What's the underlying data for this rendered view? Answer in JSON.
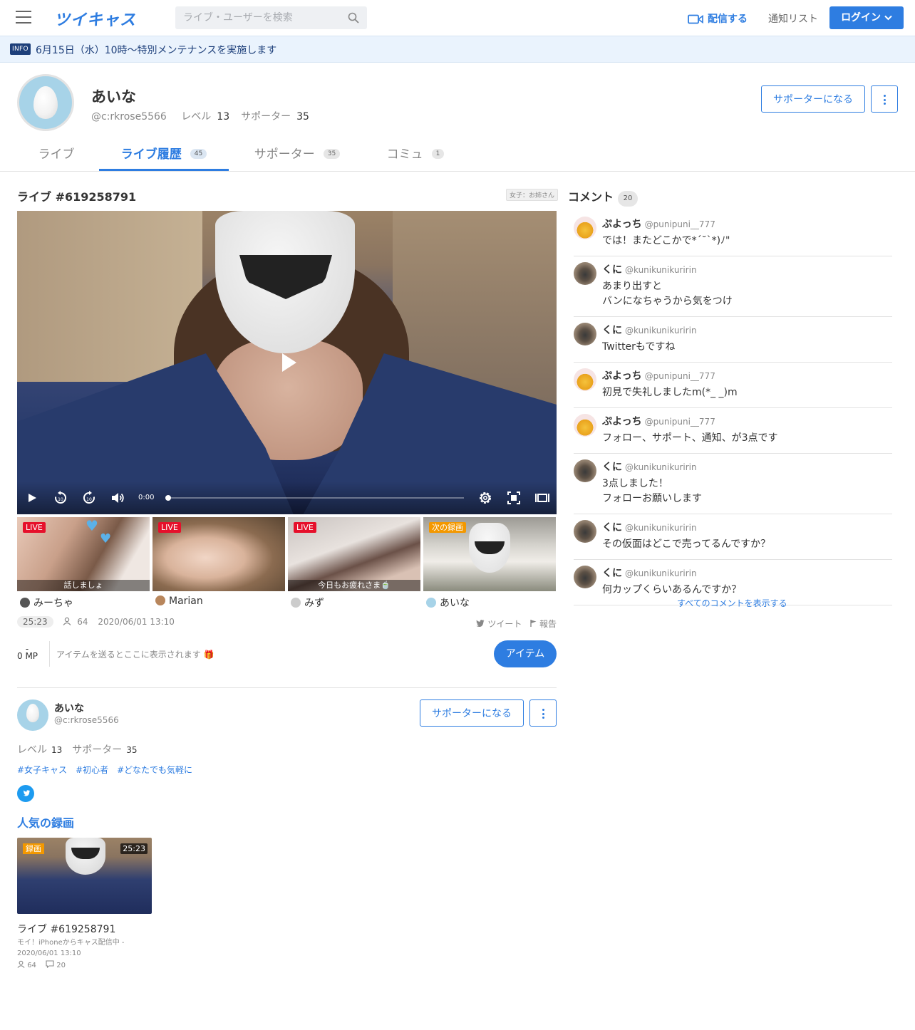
{
  "header": {
    "logo": "ツイキャス",
    "search_placeholder": "ライブ・ユーザーを検索",
    "cast_label": "配信する",
    "notif_label": "通知リスト",
    "login_label": "ログイン",
    "accent": "#2e7de1"
  },
  "info": {
    "badge": "INFO",
    "message": "6月15日（水）10時〜特別メンテナンスを実施します"
  },
  "profile": {
    "name": "あいな",
    "id": "@c:rkrose5566",
    "level_label": "レベル",
    "level": "13",
    "supporter_label": "サポーター",
    "supporters": "35",
    "support_button": "サポーターになる"
  },
  "tabs": [
    {
      "label": "ライブ",
      "count": ""
    },
    {
      "label": "ライブ履歴",
      "count": "45"
    },
    {
      "label": "サポーター",
      "count": "35"
    },
    {
      "label": "コミュ",
      "count": "1"
    }
  ],
  "live": {
    "title": "ライブ #619258791",
    "category": "女子：お姉さん",
    "time_display": "0:00",
    "progress": 0,
    "duration": "25:23",
    "viewers": "64",
    "datetime": "2020/06/01 13:10",
    "tweet": "ツイート",
    "report": "報告",
    "mp_dash": "-",
    "mp": "0 MP",
    "item_msg": "アイテムを送るとここに表示されます 🎁",
    "item_button": "アイテム"
  },
  "thumbs": [
    {
      "label": "LIVE",
      "caption": "話しましょ",
      "name": "みーちゃ"
    },
    {
      "label": "LIVE",
      "caption": "",
      "name": "Marian"
    },
    {
      "label": "LIVE",
      "caption": "今日もお疲れさま🍵",
      "name": "みず"
    },
    {
      "label": "次の録画",
      "caption": "",
      "name": "あいな"
    }
  ],
  "owner": {
    "name": "あいな",
    "id": "@c:rkrose5566",
    "level_label": "レベル",
    "level": "13",
    "supporter_label": "サポーター",
    "supporters": "35",
    "support_button": "サポーターになる",
    "tags": [
      "#女子キャス",
      "#初心者",
      "#どなたでも気軽に"
    ]
  },
  "popular": {
    "heading": "人気の録画",
    "label": "録画",
    "length": "25:23",
    "title": "ライブ #619258791",
    "desc": "モイ！iPhoneからキャス配信中 - 2020/06/01 13:10",
    "viewers": "64",
    "comments": "20"
  },
  "comments": {
    "heading": "コメント",
    "count": "20",
    "show_all": "すべてのコメントを表示する",
    "items": [
      {
        "name": "ぷよっち",
        "handle": "@punipuni__777",
        "text": "では！またどこかで*ˊ˘ˋ*)ﾉ\"",
        "av": "pu"
      },
      {
        "name": "くに",
        "handle": "@kunikunikuririn",
        "text": "あまり出すと\nバンになちゃうから気をつけ",
        "av": "ku"
      },
      {
        "name": "くに",
        "handle": "@kunikunikuririn",
        "text": "Twitterもですね",
        "av": "ku"
      },
      {
        "name": "ぷよっち",
        "handle": "@punipuni__777",
        "text": "初見で失礼しましたm(*_ _)m",
        "av": "pu"
      },
      {
        "name": "ぷよっち",
        "handle": "@punipuni__777",
        "text": "フォロー、サポート、通知、が3点です",
        "av": "pu"
      },
      {
        "name": "くに",
        "handle": "@kunikunikuririn",
        "text": "3点しました！\nフォローお願いします",
        "av": "ku"
      },
      {
        "name": "くに",
        "handle": "@kunikunikuririn",
        "text": "その仮面はどこで売ってるんですか？",
        "av": "ku"
      },
      {
        "name": "くに",
        "handle": "@kunikunikuririn",
        "text": "何カップくらいあるんですか？",
        "av": "ku"
      }
    ]
  }
}
